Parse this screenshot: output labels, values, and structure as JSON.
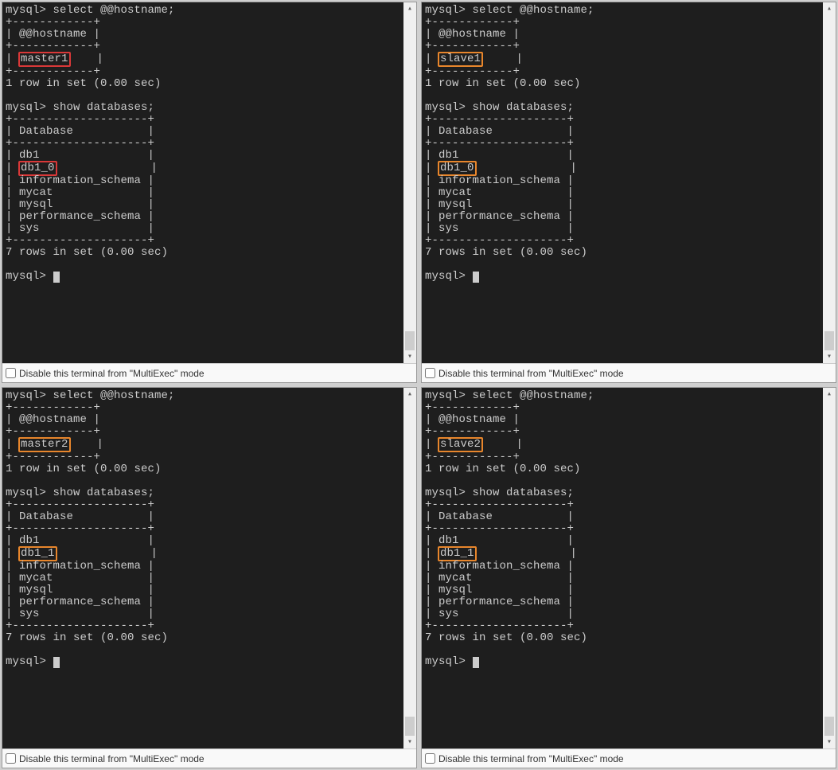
{
  "footer_label": "Disable this terminal from \"MultiExec\" mode",
  "prompt": "mysql>",
  "cmd_hostname": "select @@hostname;",
  "cmd_databases": "show databases;",
  "hostname_header": "@@hostname",
  "database_header": "Database",
  "rows_hostname": "1 row in set (0.00 sec)",
  "rows_db": "7 rows in set (0.00 sec)",
  "db_common": {
    "db1": "db1",
    "info_schema": "information_schema",
    "mycat": "mycat",
    "mysql": "mysql",
    "perf_schema": "performance_schema",
    "sys": "sys"
  },
  "panels": [
    {
      "hostname": "master1",
      "host_color": "red",
      "db_highlight": "db1_0",
      "db_color": "red"
    },
    {
      "hostname": "slave1",
      "host_color": "orange",
      "db_highlight": "db1_0",
      "db_color": "orange"
    },
    {
      "hostname": "master2",
      "host_color": "orange",
      "db_highlight": "db1_1",
      "db_color": "orange"
    },
    {
      "hostname": "slave2",
      "host_color": "orange",
      "db_highlight": "db1_1",
      "db_color": "orange"
    }
  ]
}
